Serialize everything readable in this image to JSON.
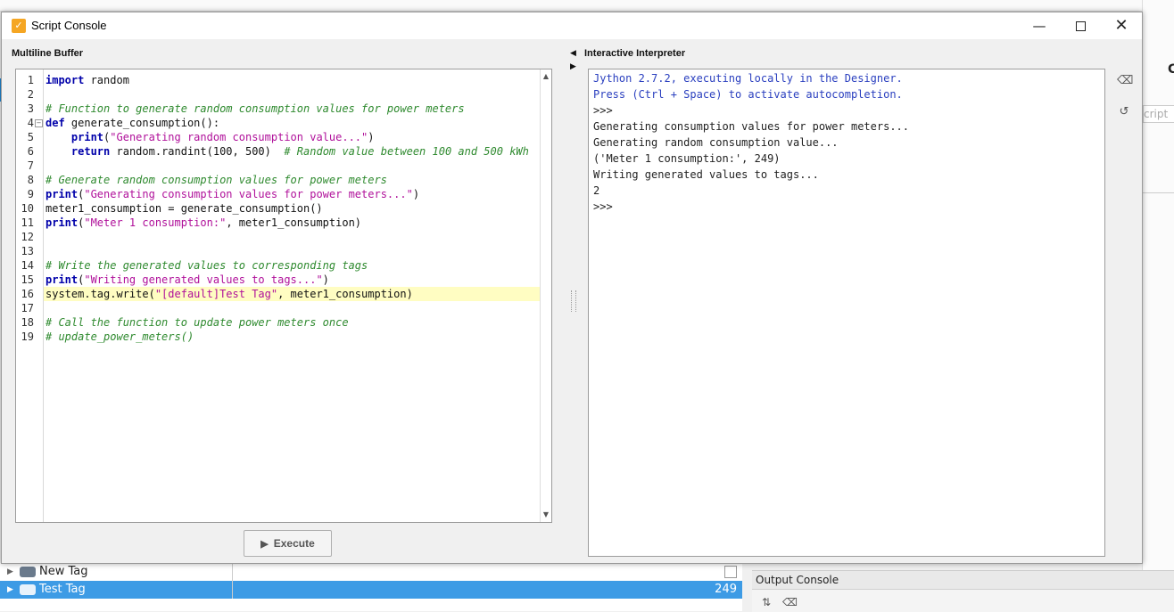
{
  "background": {
    "right_panel_letter": "C",
    "right_panel_ghost_text": "cript"
  },
  "tag_tree": {
    "rows": [
      {
        "name": "New Tag",
        "value": ""
      },
      {
        "name": "Test Tag",
        "value": "249"
      }
    ]
  },
  "output_console": {
    "title": "Output Console"
  },
  "dialog": {
    "title": "Script Console",
    "app_icon_glyph": "✓",
    "window_buttons": {
      "minimize": "—",
      "close": "✕"
    },
    "multiline_buffer_label": "Multiline Buffer",
    "interpreter_label": "Interactive Interpreter",
    "execute_label": "Execute",
    "highlighted_line": 16,
    "code_lines": [
      [
        {
          "t": "kw",
          "v": "import"
        },
        {
          "t": "nm",
          "v": " random"
        }
      ],
      [],
      [
        {
          "t": "cm",
          "v": "# Function to generate random consumption values for power meters"
        }
      ],
      [
        {
          "t": "kw",
          "v": "def"
        },
        {
          "t": "nm",
          "v": " generate_consumption():"
        }
      ],
      [
        {
          "t": "nm",
          "v": "    "
        },
        {
          "t": "kw",
          "v": "print"
        },
        {
          "t": "nm",
          "v": "("
        },
        {
          "t": "st",
          "v": "\"Generating random consumption value...\""
        },
        {
          "t": "nm",
          "v": ")"
        }
      ],
      [
        {
          "t": "nm",
          "v": "    "
        },
        {
          "t": "kw",
          "v": "return"
        },
        {
          "t": "nm",
          "v": " random.randint(100, 500)  "
        },
        {
          "t": "cm",
          "v": "# Random value between 100 and 500 kWh"
        }
      ],
      [],
      [
        {
          "t": "cm",
          "v": "# Generate random consumption values for power meters"
        }
      ],
      [
        {
          "t": "kw",
          "v": "print"
        },
        {
          "t": "nm",
          "v": "("
        },
        {
          "t": "st",
          "v": "\"Generating consumption values for power meters...\""
        },
        {
          "t": "nm",
          "v": ")"
        }
      ],
      [
        {
          "t": "nm",
          "v": "meter1_consumption = generate_consumption()"
        }
      ],
      [
        {
          "t": "kw",
          "v": "print"
        },
        {
          "t": "nm",
          "v": "("
        },
        {
          "t": "st",
          "v": "\"Meter 1 consumption:\""
        },
        {
          "t": "nm",
          "v": ", meter1_consumption)"
        }
      ],
      [],
      [],
      [
        {
          "t": "cm",
          "v": "# Write the generated values to corresponding tags"
        }
      ],
      [
        {
          "t": "kw",
          "v": "print"
        },
        {
          "t": "nm",
          "v": "("
        },
        {
          "t": "st",
          "v": "\"Writing generated values to tags...\""
        },
        {
          "t": "nm",
          "v": ")"
        }
      ],
      [
        {
          "t": "nm",
          "v": "system.tag.write("
        },
        {
          "t": "st",
          "v": "\"[default]Test Tag\""
        },
        {
          "t": "nm",
          "v": ", meter1_consumption)"
        }
      ],
      [],
      [
        {
          "t": "cm",
          "v": "# Call the function to update power meters once"
        }
      ],
      [
        {
          "t": "cm",
          "v": "# update_power_meters()"
        }
      ]
    ],
    "interpreter_lines": [
      {
        "text": "Jython 2.7.2, executing locally in the Designer.",
        "style": "blue"
      },
      {
        "text": "Press (Ctrl + Space) to activate autocompletion.",
        "style": "blue"
      },
      {
        "text": ">>>",
        "style": ""
      },
      {
        "text": "Generating consumption values for power meters...",
        "style": ""
      },
      {
        "text": "Generating random consumption value...",
        "style": ""
      },
      {
        "text": "('Meter 1 consumption:', 249)",
        "style": ""
      },
      {
        "text": "Writing generated values to tags...",
        "style": ""
      },
      {
        "text": "2",
        "style": ""
      },
      {
        "text": ">>>",
        "style": ""
      }
    ]
  }
}
